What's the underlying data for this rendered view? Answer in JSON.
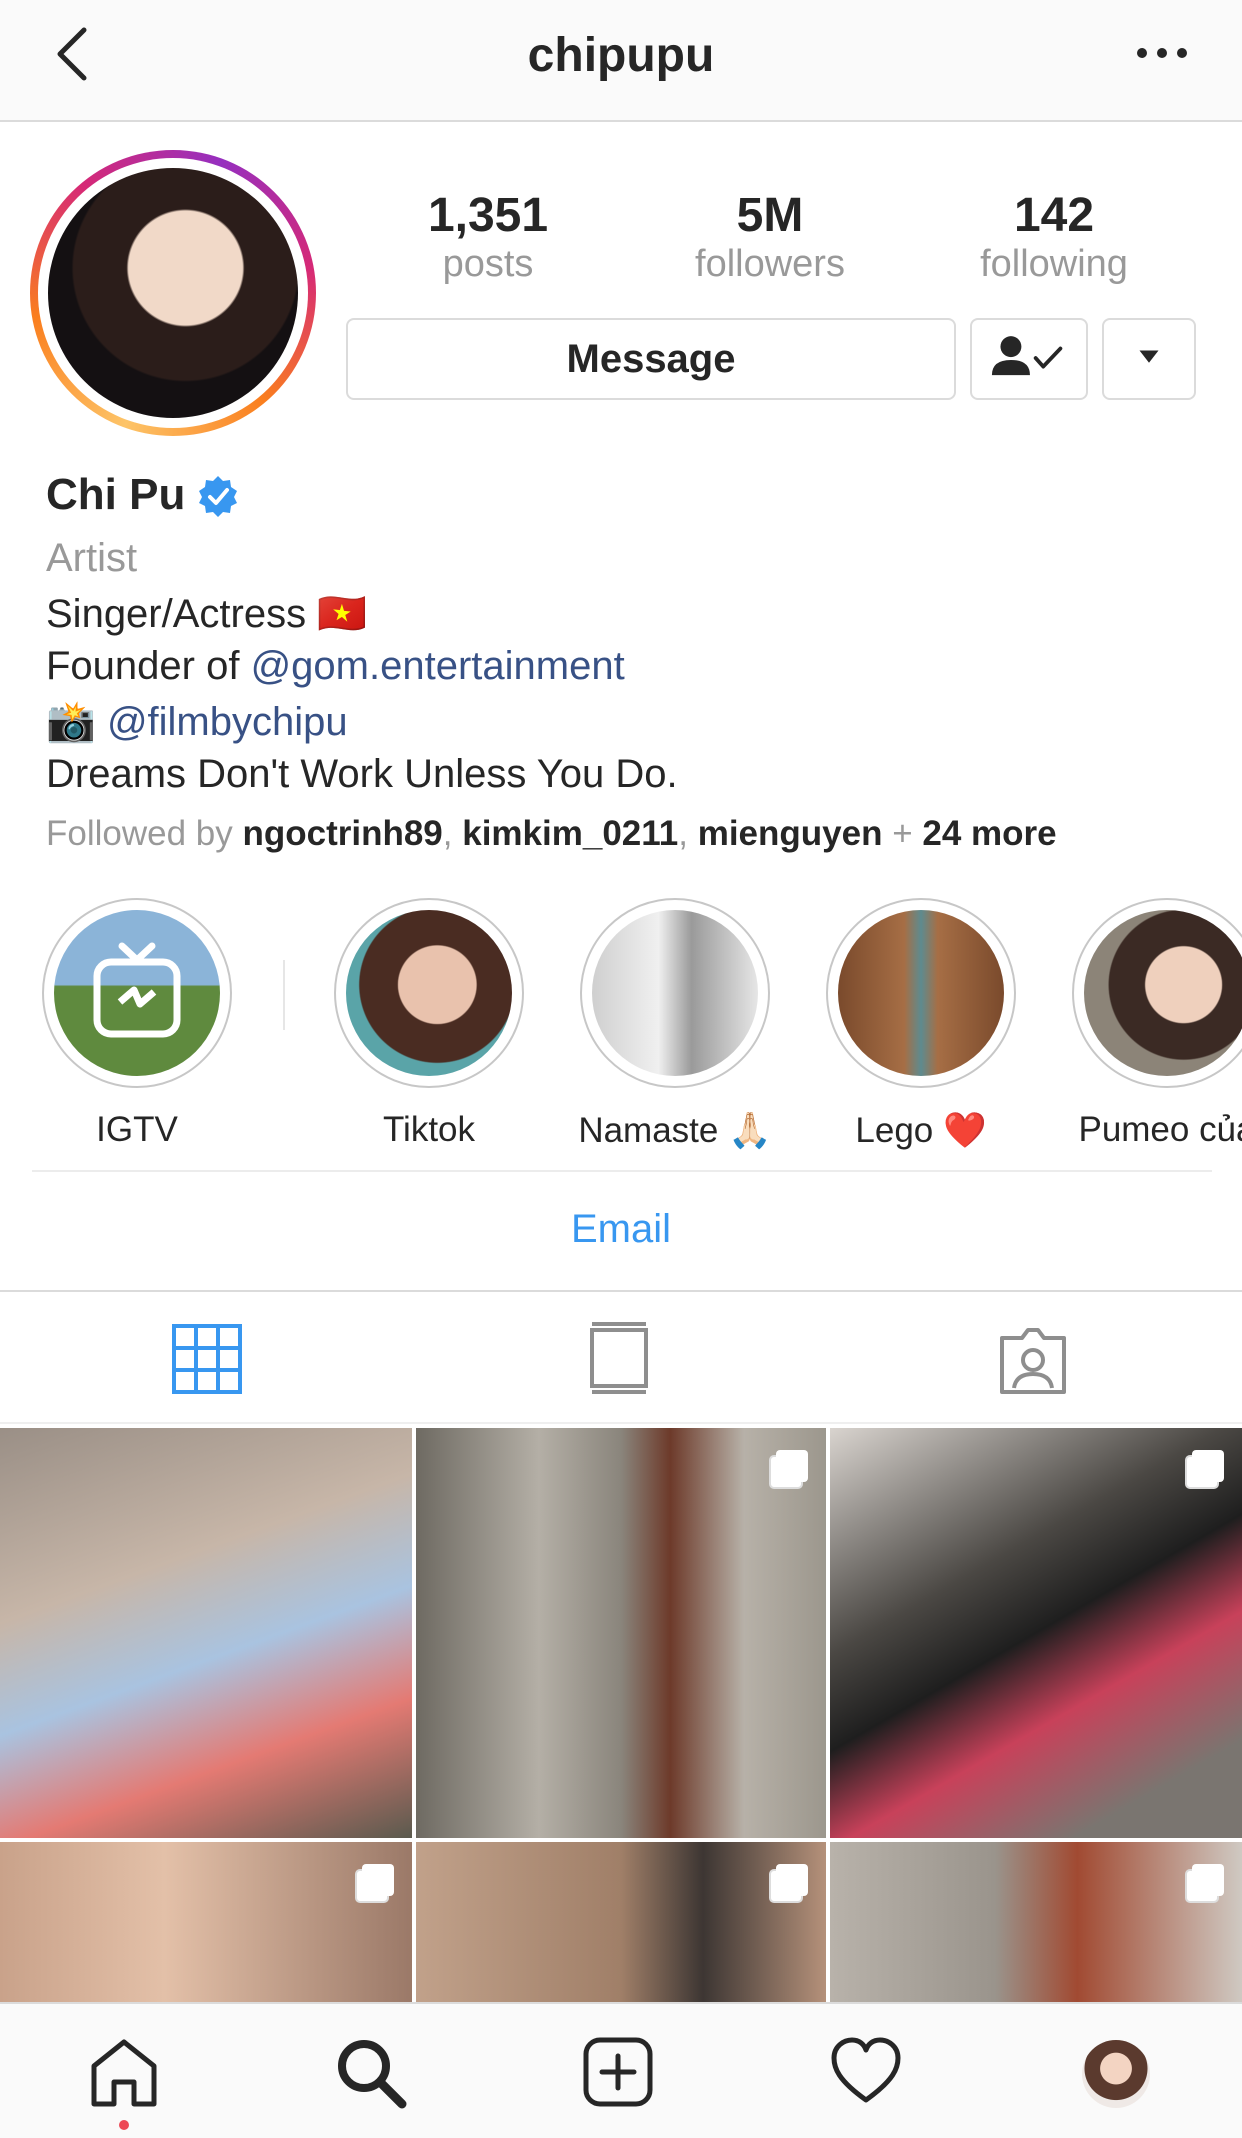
{
  "header": {
    "username": "chipupu"
  },
  "stats": [
    {
      "value": "1,351",
      "label": "posts"
    },
    {
      "value": "5M",
      "label": "followers"
    },
    {
      "value": "142",
      "label": "following"
    }
  ],
  "actions": {
    "message_label": "Message"
  },
  "profile": {
    "name": "Chi Pu",
    "category": "Artist",
    "bio": {
      "line1": "Singer/Actress 🇻🇳",
      "line2_prefix": "Founder of ",
      "line2_link": "@gom.entertainment",
      "line3_emoji": "📸",
      "line3_link": "@filmbychipu",
      "line4": "Dreams Don't Work Unless You Do."
    },
    "followed_by": {
      "prefix": "Followed by ",
      "users": [
        "ngoctrinh89",
        "kimkim_0211",
        "mienguyen"
      ],
      "more": "24 more"
    }
  },
  "highlights": [
    {
      "label": "IGTV"
    },
    {
      "label": "Tiktok"
    },
    {
      "label": "Namaste 🙏🏻"
    },
    {
      "label": "Lego ❤️"
    },
    {
      "label": "Pumeo của"
    }
  ],
  "contact": {
    "email_label": "Email"
  },
  "tabs": [
    "grid-icon",
    "feed-icon",
    "tagged-icon"
  ],
  "colors": {
    "link": "#385185",
    "email": "#3897f0",
    "active_tab": "#3897f0",
    "notification": "#ed4956"
  },
  "bottom_nav": [
    "home-icon",
    "search-icon",
    "new-post-icon",
    "activity-icon",
    "profile-avatar"
  ]
}
